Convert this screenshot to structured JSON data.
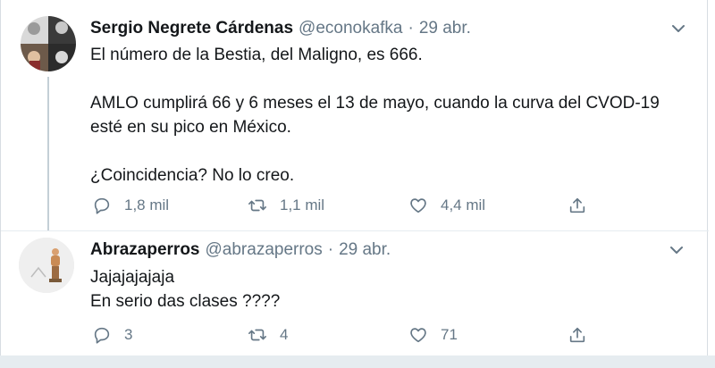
{
  "tweets": [
    {
      "author_name": "Sergio Negrete Cárdenas",
      "handle": "@econokafka",
      "separator": "·",
      "date": "29 abr.",
      "text": "El número de la Bestia, del Maligno, es 666.\n\nAMLO cumplirá 66 y 6 meses el 13 de mayo, cuando la curva del CVOD-19\nesté en su pico en México.\n\n¿Coincidencia? No lo creo.",
      "replies": "1,8 mil",
      "retweets": "1,1 mil",
      "likes": "4,4 mil"
    },
    {
      "author_name": "Abrazaperros",
      "handle": "@abrazaperros",
      "separator": "·",
      "date": "29 abr.",
      "text": "Jajajajajaja\nEn serio das clases ????",
      "replies": "3",
      "retweets": "4",
      "likes": "71"
    }
  ],
  "icons": {
    "reply": "reply-icon",
    "retweet": "retweet-icon",
    "like": "like-icon",
    "share": "share-icon",
    "more": "chevron-down-icon"
  },
  "colors": {
    "text_primary": "#14171a",
    "text_secondary": "#657786",
    "divider": "#e6ecf0",
    "thread_line": "#c4cfd6"
  }
}
